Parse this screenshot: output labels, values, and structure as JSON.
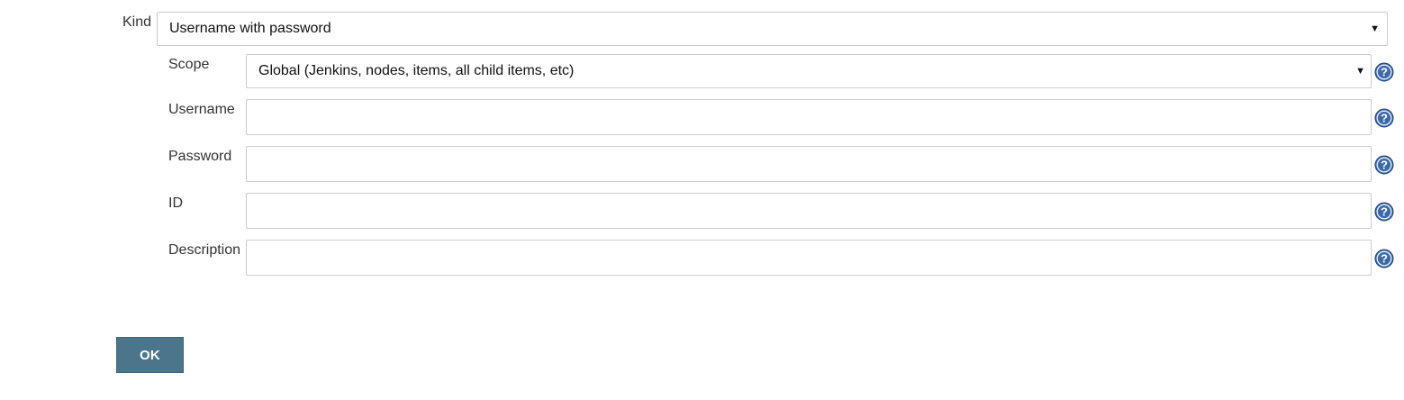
{
  "kind": {
    "label": "Kind",
    "selected": "Username with password"
  },
  "scope": {
    "label": "Scope",
    "selected": "Global (Jenkins, nodes, items, all child items, etc)"
  },
  "username": {
    "label": "Username",
    "value": ""
  },
  "password": {
    "label": "Password",
    "value": ""
  },
  "id": {
    "label": "ID",
    "value": ""
  },
  "description": {
    "label": "Description",
    "value": ""
  },
  "help_icon": {
    "name": "help-icon",
    "glyph": "?"
  },
  "select_caret_glyph": "▼",
  "ok_button": {
    "label": "OK"
  },
  "colors": {
    "ok_button_bg": "#4b758b",
    "help_icon_bg": "#3b6aa8",
    "field_border": "#cccccc"
  }
}
